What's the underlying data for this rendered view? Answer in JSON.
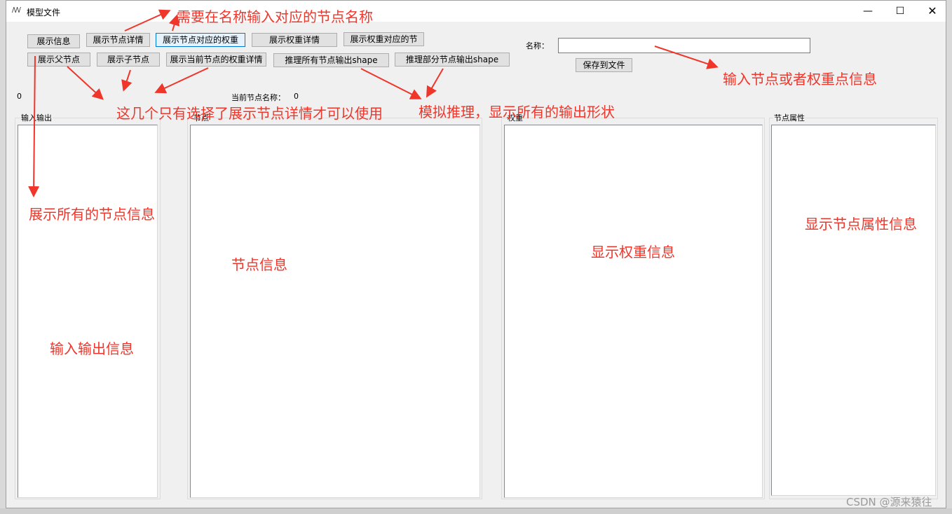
{
  "window": {
    "title": "模型文件",
    "minimize": "—",
    "maximize": "☐",
    "close": "✕"
  },
  "toolbar": {
    "show_info": "展示信息",
    "show_node_detail": "展示节点详情",
    "show_node_weight": "展示节点对应的权重",
    "show_weight_detail": "展示权重详情",
    "show_weight_node": "展示权重对应的节",
    "show_parent_node": "展示父节点",
    "show_child_node": "展示子节点",
    "show_current_weight_detail": "展示当前节点的权重详情",
    "infer_all_shape": "推理所有节点输出shape",
    "infer_partial_shape": "推理部分节点输出shape",
    "name_label": "名称：",
    "name_value": "",
    "save_to_file": "保存到文件"
  },
  "status": {
    "count": "0",
    "current_node_label": "当前节点名称：",
    "current_node_value": "0"
  },
  "panels": {
    "io": "输入输出",
    "node": "节点",
    "weight": "权重",
    "attr": "节点属性"
  },
  "annotations": {
    "name_hint": "需要在名称输入对应的节点名称",
    "input_hint": "输入节点或者权重点信息",
    "detail_hint": "这几个只有选择了展示节点详情才可以使用",
    "infer_hint": "模拟推理，显示所有的输出形状",
    "show_all_hint": "展示所有的节点信息",
    "node_info": "节点信息",
    "weight_info": "显示权重信息",
    "attr_info": "显示节点属性信息",
    "io_info": "输入输出信息"
  },
  "colors": {
    "annotation": "#f0352a",
    "window_bg": "#f0f0f0",
    "focus_border": "#0078d7"
  },
  "watermark": "CSDN @源来猿往"
}
